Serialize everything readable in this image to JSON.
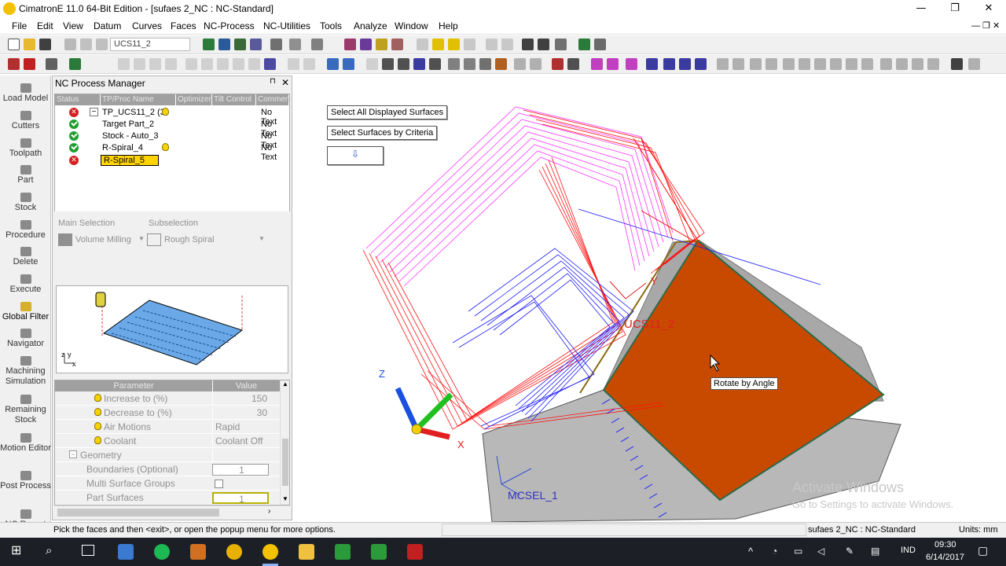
{
  "window": {
    "title": "CimatronE 11.0 64-Bit Edition - [sufaes 2_NC : NC-Standard]",
    "minimize": "—",
    "restore": "❐",
    "close": "✕"
  },
  "menu": [
    "File",
    "Edit",
    "View",
    "Datum",
    "Curves",
    "Faces",
    "NC-Process",
    "NC-Utilities",
    "Tools",
    "Analyze",
    "Window",
    "Help"
  ],
  "toolbar": {
    "ucs_combo": "UCS11_2"
  },
  "sidebar": {
    "items": [
      "Load Model",
      "Cutters",
      "Toolpath",
      "Part",
      "Stock",
      "Procedure",
      "Delete",
      "Execute",
      "Global Filter",
      "Navigator",
      "Machining Simulation",
      "Remaining Stock",
      "Motion Editor",
      "Post Process",
      "NC Report"
    ]
  },
  "nc_process_manager": {
    "title": "NC Process Manager",
    "pin": "📌",
    "close": "✕",
    "columns": [
      "Status",
      "TP/Proc Name",
      "",
      "Optimizer",
      "Tilt Control",
      "Comment"
    ],
    "rows": [
      {
        "status": "error",
        "name": "TP_UCS11_2 (3",
        "comment": "No Text",
        "expander": "−"
      },
      {
        "status": "ok",
        "name": "Target Part_2",
        "comment": "No Text"
      },
      {
        "status": "ok",
        "name": "Stock - Auto_3",
        "comment": "No Text"
      },
      {
        "status": "ok",
        "name": "R-Spiral_4",
        "comment": "No Text"
      },
      {
        "status": "error",
        "name": "R-Spiral_5",
        "comment": ""
      }
    ],
    "main_selection_label": "Main Selection",
    "subselection_label": "Subselection",
    "main_selection_value": "Volume Milling",
    "subselection_value": "Rough Spiral",
    "axis_label_z": "z",
    "axis_label_y": "y",
    "axis_label_x": "x",
    "param_header_name": "Parameter",
    "param_header_value": "Value",
    "params": [
      {
        "name": "Increase to (%)",
        "value": "150",
        "bulb": true
      },
      {
        "name": "Decrease to (%)",
        "value": "30",
        "bulb": true
      },
      {
        "name": "Air Motions",
        "value": "Rapid",
        "bulb": true
      },
      {
        "name": "Coolant",
        "value": "Coolant Off",
        "bulb": true
      },
      {
        "name": "Geometry",
        "value": "",
        "group": true
      },
      {
        "name": "Boundaries (Optional)",
        "value": "1"
      },
      {
        "name": "Multi Surface Groups",
        "value": ""
      },
      {
        "name": "Part Surfaces",
        "value": "1"
      }
    ]
  },
  "viewport": {
    "btn_select_all": "Select All Displayed Surfaces",
    "btn_select_criteria": "Select Surfaces by Criteria",
    "tooltip": "Rotate by Angle",
    "ucs_label_1": "UCS11_2",
    "ucs_label_2": "MCSEL_1",
    "axis_z": "Z",
    "axis_x": "X",
    "axis_y": "Y",
    "watermark_title": "Activate Windows",
    "watermark_sub": "Go to Settings to activate Windows."
  },
  "statusbar": {
    "hint": "Pick the faces and then <exit>, or open the popup menu for more options.",
    "file": "sufaes 2_NC : NC-Standard",
    "units": "Units: mm"
  },
  "taskbar": {
    "lang": "IND",
    "time": "09:30",
    "date": "6/14/2017"
  },
  "colors": {
    "orange_face": "#c84a00",
    "toolpath_red": "#ff1010",
    "toolpath_blue": "#1a1aff",
    "toolpath_magenta": "#ff20ff"
  }
}
